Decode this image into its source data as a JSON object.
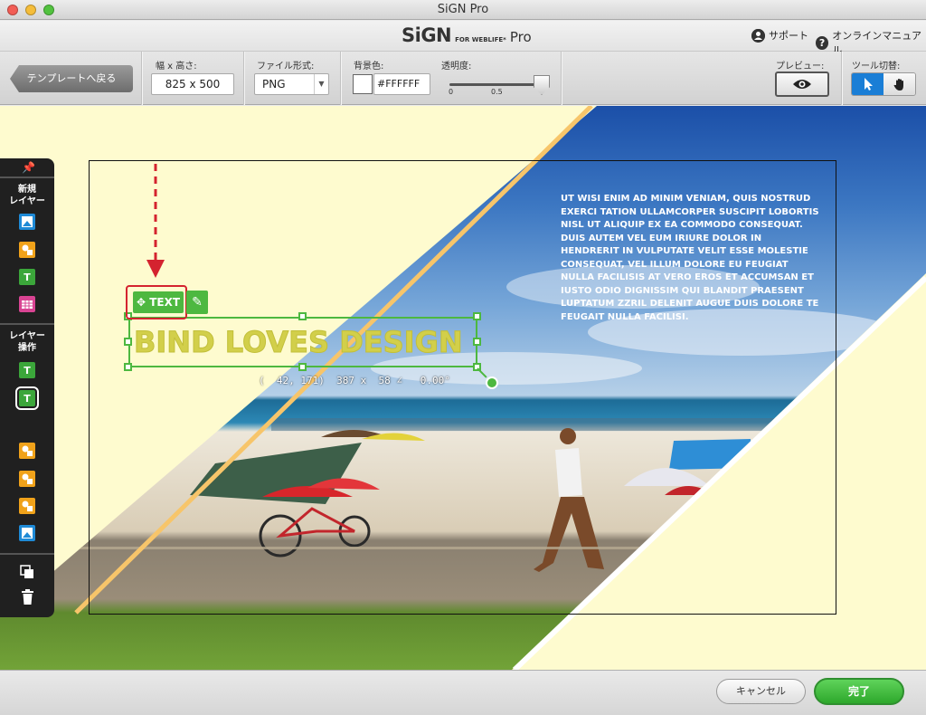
{
  "window": {
    "title": "SiGN Pro"
  },
  "header": {
    "logo_main": "SiGN",
    "logo_sub": "FOR WEBLIFE*",
    "logo_pro": "Pro",
    "support_label": "サポート",
    "manual_label": "オンラインマニュアル"
  },
  "toolbar": {
    "back_label": "テンプレートへ戻る",
    "size_label": "幅 x 高さ:",
    "size_value": "825 x 500",
    "format_label": "ファイル形式:",
    "format_value": "PNG",
    "bgcolor_label": "背景色:",
    "bgcolor_value": "#FFFFFF",
    "opacity_label": "透明度:",
    "opacity_min": "0",
    "opacity_mid": "0.5",
    "opacity_value": 1.0,
    "preview_label": "プレビュー:",
    "tool_label": "ツール切替:"
  },
  "left_panel": {
    "new_layer_label": "新規\nレイヤー",
    "layer_ops_label": "レイヤー\n操作",
    "text_glyph": "T"
  },
  "canvas": {
    "text_tag_label": "TEXT",
    "title_text": "BIND LOVES DESIGN",
    "readout": "(  42, 171)  387 x  58 ∠   0.00°",
    "body_text": "UT WISI ENIM AD MINIM VENIAM, QUIS NOSTRUD EXERCI TATION ULLAMCORPER SUSCIPIT LOBORTIS NISL UT ALIQUIP EX EA COMMODO CONSEQUAT. DUIS AUTEM VEL EUM IRIURE DOLOR IN HENDRERIT IN VULPUTATE VELIT ESSE MOLESTIE CONSEQUAT, VEL ILLUM DOLORE EU FEUGIAT NULLA FACILISIS AT VERO EROS ET ACCUMSAN ET IUSTO ODIO DIGNISSIM QUI BLANDIT PRAESENT LUPTATUM ZZRIL DELENIT AUGUE DUIS DOLORE TE FEUGAIT NULLA FACILISI.",
    "title_color": "#d2cf4a",
    "selection_color": "#4db840",
    "highlight_color": "#d4232f",
    "background_color": "#fefbcf"
  },
  "footer": {
    "cancel_label": "キャンセル",
    "done_label": "完了"
  },
  "icons": {
    "pin": "pin-icon",
    "image_layer": "image-layer-icon",
    "shape_layer": "shape-layer-icon",
    "text_layer": "text-layer-icon",
    "table_layer": "table-layer-icon",
    "duplicate": "duplicate-icon",
    "trash": "trash-icon",
    "eye": "eye-icon",
    "pointer": "pointer-icon",
    "hand": "hand-icon",
    "move": "move-icon",
    "pencil": "pencil-icon"
  }
}
